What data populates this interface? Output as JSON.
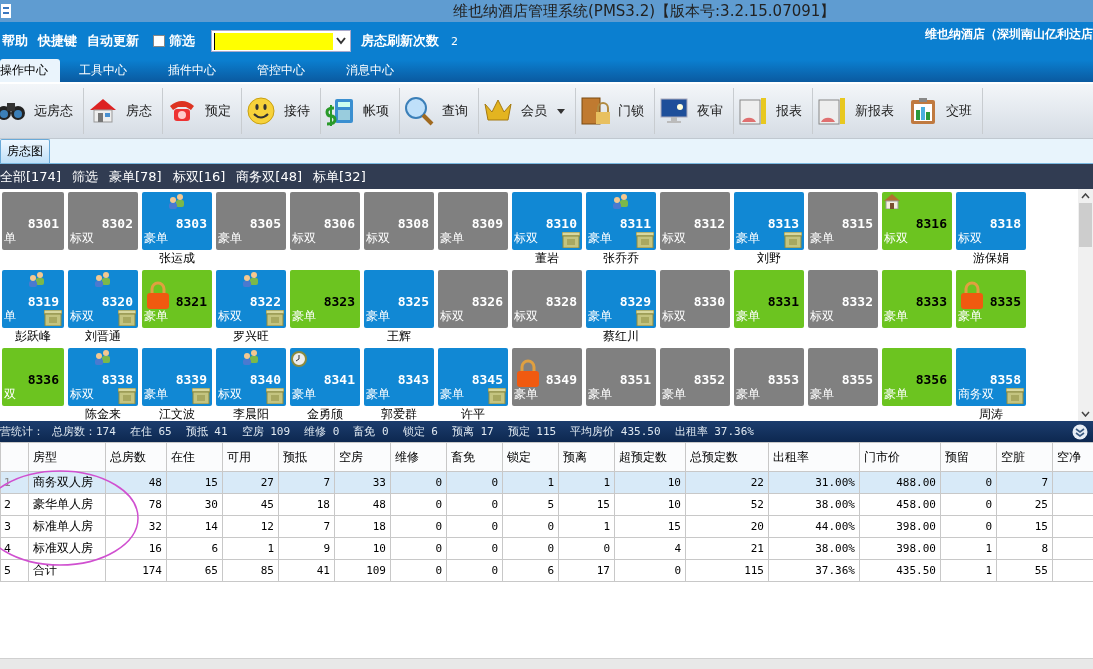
{
  "window": {
    "title": "维也纳酒店管理系统(PMS3.2)【版本号:3.2.15.07091】"
  },
  "menu_bar": {
    "items": [
      "帮助",
      "快捷键",
      "自动更新"
    ],
    "filter_checkbox": {
      "label": "筛选",
      "checked": false
    },
    "refresh_label": "房态刷新次数",
    "refresh_count": "2",
    "hotel_name": "维也纳酒店（深圳南山亿利达店"
  },
  "tabs": [
    {
      "label": "操作中心",
      "selected": true
    },
    {
      "label": "工具中心",
      "selected": false
    },
    {
      "label": "插件中心",
      "selected": false
    },
    {
      "label": "管控中心",
      "selected": false
    },
    {
      "label": "消息中心",
      "selected": false
    }
  ],
  "toolbar": [
    {
      "label": "远房态",
      "has_menu": false
    },
    {
      "label": "房态",
      "has_menu": false
    },
    {
      "label": "预定",
      "has_menu": false
    },
    {
      "label": "接待",
      "has_menu": false
    },
    {
      "label": "帐项",
      "has_menu": false
    },
    {
      "label": "查询",
      "has_menu": false
    },
    {
      "label": "会员",
      "has_menu": true
    },
    {
      "label": "门锁",
      "has_menu": false
    },
    {
      "label": "夜审",
      "has_menu": false
    },
    {
      "label": "报表",
      "has_menu": false
    },
    {
      "label": "新报表",
      "has_menu": false
    },
    {
      "label": "交班",
      "has_menu": false
    }
  ],
  "view_tabs": [
    {
      "label": "房态图",
      "selected": true
    }
  ],
  "filter_bar": [
    "全部[174]",
    "筛选",
    "豪单[78]",
    "标双[16]",
    "商务双[48]",
    "标单[32]"
  ],
  "room_rows": [
    [
      {
        "number": "8301",
        "type": "单",
        "color": "#808080"
      },
      {
        "number": "8302",
        "type": "标双",
        "color": "#808080"
      },
      {
        "number": "8303",
        "type": "豪单",
        "color": "#1188d4",
        "guest": "张运成",
        "marks": [
          {
            "kind": "guests"
          }
        ]
      },
      {
        "number": "8305",
        "type": "豪单",
        "color": "#808080"
      },
      {
        "number": "8306",
        "type": "标双",
        "color": "#808080"
      },
      {
        "number": "8308",
        "type": "标双",
        "color": "#808080"
      },
      {
        "number": "8309",
        "type": "豪单",
        "color": "#808080"
      },
      {
        "number": "8310",
        "type": "标双",
        "color": "#1188d4",
        "guest": "董岩",
        "marks": [
          {
            "kind": "bin"
          }
        ]
      },
      {
        "number": "8311",
        "type": "豪单",
        "color": "#1188d4",
        "guest": "张乔乔",
        "marks": [
          {
            "kind": "guests"
          },
          {
            "kind": "bin"
          }
        ]
      },
      {
        "number": "8312",
        "type": "标双",
        "color": "#808080"
      },
      {
        "number": "8313",
        "type": "豪单",
        "color": "#1188d4",
        "guest": "刘野",
        "marks": [
          {
            "kind": "bin"
          }
        ]
      },
      {
        "number": "8315",
        "type": "豪单",
        "color": "#808080"
      },
      {
        "number": "8316",
        "type": "标双",
        "color": "#6cc420",
        "marks": [
          {
            "kind": "house"
          }
        ]
      },
      {
        "number": "8318",
        "type": "标双",
        "color": "#1188d4",
        "guest": "游保娟"
      }
    ],
    [
      {
        "number": "8319",
        "type": "单",
        "color": "#1188d4",
        "guest": "彭跃峰",
        "marks": [
          {
            "kind": "guests"
          },
          {
            "kind": "bin"
          }
        ]
      },
      {
        "number": "8320",
        "type": "标双",
        "color": "#1188d4",
        "guest": "刘晋通",
        "marks": [
          {
            "kind": "guests"
          },
          {
            "kind": "bin"
          }
        ]
      },
      {
        "number": "8321",
        "type": "豪单",
        "color": "#6cc420",
        "marks": [
          {
            "kind": "lock"
          }
        ]
      },
      {
        "number": "8322",
        "type": "标双",
        "color": "#1188d4",
        "guest": "罗兴旺",
        "marks": [
          {
            "kind": "guests"
          },
          {
            "kind": "bin"
          }
        ]
      },
      {
        "number": "8323",
        "type": "豪单",
        "color": "#6cc420"
      },
      {
        "number": "8325",
        "type": "豪单",
        "color": "#1188d4",
        "guest": "王辉"
      },
      {
        "number": "8326",
        "type": "标双",
        "color": "#808080"
      },
      {
        "number": "8328",
        "type": "标双",
        "color": "#808080"
      },
      {
        "number": "8329",
        "type": "豪单",
        "color": "#1188d4",
        "guest": "蔡红川",
        "marks": [
          {
            "kind": "bin"
          }
        ]
      },
      {
        "number": "8330",
        "type": "标双",
        "color": "#808080"
      },
      {
        "number": "8331",
        "type": "豪单",
        "color": "#6cc420"
      },
      {
        "number": "8332",
        "type": "标双",
        "color": "#808080"
      },
      {
        "number": "8333",
        "type": "豪单",
        "color": "#6cc420"
      },
      {
        "number": "8335",
        "type": "豪单",
        "color": "#6cc420",
        "marks": [
          {
            "kind": "lock"
          }
        ]
      }
    ],
    [
      {
        "number": "8336",
        "type": "双",
        "color": "#6cc420"
      },
      {
        "number": "8338",
        "type": "标双",
        "color": "#1188d4",
        "guest": "陈金来",
        "marks": [
          {
            "kind": "guests"
          },
          {
            "kind": "bin"
          }
        ]
      },
      {
        "number": "8339",
        "type": "豪单",
        "color": "#1188d4",
        "guest": "江文波",
        "marks": [
          {
            "kind": "bin"
          }
        ]
      },
      {
        "number": "8340",
        "type": "标双",
        "color": "#1188d4",
        "guest": "李晨阳",
        "marks": [
          {
            "kind": "guests"
          },
          {
            "kind": "bin"
          }
        ]
      },
      {
        "number": "8341",
        "type": "豪单",
        "color": "#1188d4",
        "guest": "金勇颀",
        "marks": [
          {
            "kind": "clock"
          }
        ]
      },
      {
        "number": "8343",
        "type": "豪单",
        "color": "#1188d4",
        "guest": "郭爱群"
      },
      {
        "number": "8345",
        "type": "豪单",
        "color": "#1188d4",
        "guest": "许平",
        "marks": [
          {
            "kind": "bin"
          }
        ]
      },
      {
        "number": "8349",
        "type": "豪单",
        "color": "#808080",
        "marks": [
          {
            "kind": "lock"
          }
        ]
      },
      {
        "number": "8351",
        "type": "豪单",
        "color": "#808080"
      },
      {
        "number": "8352",
        "type": "豪单",
        "color": "#808080"
      },
      {
        "number": "8353",
        "type": "豪单",
        "color": "#808080"
      },
      {
        "number": "8355",
        "type": "豪单",
        "color": "#808080"
      },
      {
        "number": "8356",
        "type": "豪单",
        "color": "#6cc420"
      },
      {
        "number": "8358",
        "type": "商务双",
        "color": "#1188d4",
        "guest": "周涛",
        "marks": [
          {
            "kind": "bin"
          }
        ]
      }
    ]
  ],
  "stats": [
    "营统计：",
    "总房数：174",
    "在住 65",
    "预抵 41",
    "空房 109",
    "维修 0",
    "畜免 0",
    "锁定 6",
    "预离 17",
    "预定 115",
    "平均房价 435.50",
    "出租率 37.36%"
  ],
  "table": {
    "columns": [
      "房型",
      "总房数",
      "在住",
      "可用",
      "预抵",
      "空房",
      "维修",
      "畜免",
      "锁定",
      "预离",
      "超预定数",
      "总预定数",
      "出租率",
      "门市价",
      "预留",
      "空脏",
      "空净"
    ],
    "rows": [
      {
        "number": "1",
        "selected": true,
        "cells": [
          "商务双人房",
          "48",
          "15",
          "27",
          "7",
          "33",
          "0",
          "0",
          "1",
          "1",
          "10",
          "22",
          "31.00%",
          "488.00",
          "0",
          "7"
        ]
      },
      {
        "number": "2",
        "selected": false,
        "cells": [
          "豪华单人房",
          "78",
          "30",
          "45",
          "18",
          "48",
          "0",
          "0",
          "5",
          "15",
          "10",
          "52",
          "38.00%",
          "458.00",
          "0",
          "25"
        ]
      },
      {
        "number": "3",
        "selected": false,
        "cells": [
          "标准单人房",
          "32",
          "14",
          "12",
          "7",
          "18",
          "0",
          "0",
          "0",
          "1",
          "15",
          "20",
          "44.00%",
          "398.00",
          "0",
          "15"
        ]
      },
      {
        "number": "4",
        "selected": false,
        "cells": [
          "标准双人房",
          "16",
          "6",
          "1",
          "9",
          "10",
          "0",
          "0",
          "0",
          "0",
          "4",
          "21",
          "38.00%",
          "398.00",
          "1",
          "8"
        ]
      },
      {
        "number": "5",
        "selected": false,
        "cells": [
          "合计",
          "174",
          "65",
          "85",
          "41",
          "109",
          "0",
          "0",
          "6",
          "17",
          "0",
          "115",
          "37.36%",
          "435.50",
          "1",
          "55"
        ]
      }
    ]
  }
}
